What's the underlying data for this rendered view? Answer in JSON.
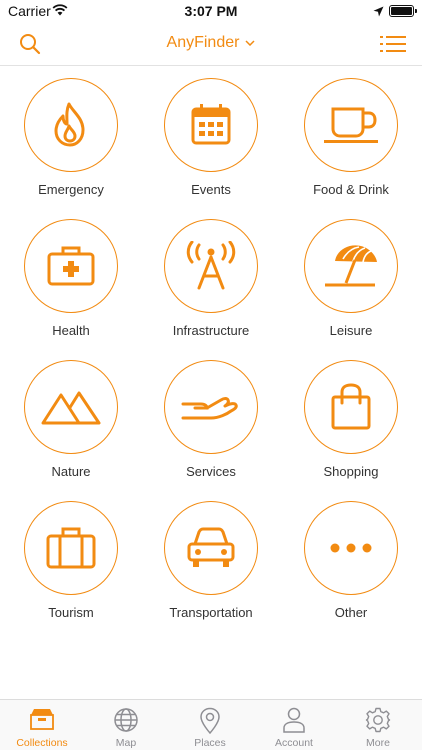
{
  "status_bar": {
    "carrier": "Carrier",
    "time": "3:07 PM"
  },
  "nav": {
    "title": "AnyFinder",
    "accent_color": "#f28b12"
  },
  "categories": [
    {
      "label": "Emergency",
      "icon": "flame-icon"
    },
    {
      "label": "Events",
      "icon": "calendar-icon"
    },
    {
      "label": "Food & Drink",
      "icon": "coffee-cup-icon"
    },
    {
      "label": "Health",
      "icon": "first-aid-kit-icon"
    },
    {
      "label": "Infrastructure",
      "icon": "radio-tower-icon"
    },
    {
      "label": "Leisure",
      "icon": "beach-umbrella-icon"
    },
    {
      "label": "Nature",
      "icon": "mountains-icon"
    },
    {
      "label": "Services",
      "icon": "open-hand-icon"
    },
    {
      "label": "Shopping",
      "icon": "shopping-bag-icon"
    },
    {
      "label": "Tourism",
      "icon": "suitcase-icon"
    },
    {
      "label": "Transportation",
      "icon": "car-icon"
    },
    {
      "label": "Other",
      "icon": "more-dots-icon"
    }
  ],
  "tabs": [
    {
      "label": "Collections",
      "icon": "box-icon",
      "active": true
    },
    {
      "label": "Map",
      "icon": "globe-icon",
      "active": false
    },
    {
      "label": "Places",
      "icon": "map-pin-icon",
      "active": false
    },
    {
      "label": "Account",
      "icon": "person-icon",
      "active": false
    },
    {
      "label": "More",
      "icon": "gear-icon",
      "active": false
    }
  ]
}
